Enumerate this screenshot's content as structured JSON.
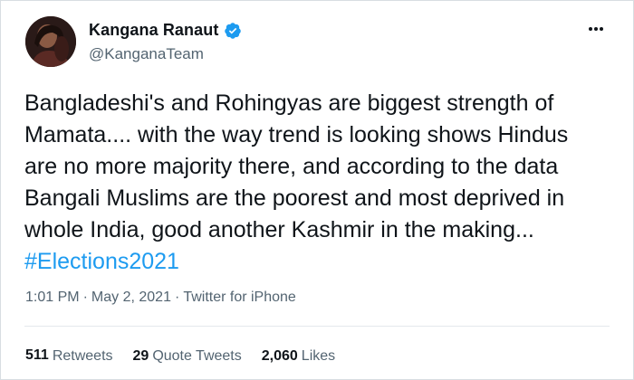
{
  "tweet": {
    "author": {
      "display_name": "Kangana Ranaut",
      "handle": "@KanganaTeam",
      "verified": true
    },
    "text": "Bangladeshi's and Rohingyas are biggest strength of\nMamata.... with the way trend is looking shows Hindus\nare no more majority there, and according to the data\nBangali Muslims are the poorest and most deprived in\nwhole India, good another Kashmir in the making...",
    "hashtag": "#Elections2021",
    "time": "1:01 PM",
    "date": "May 2, 2021",
    "source": "Twitter for iPhone",
    "separator": "·",
    "more_icon": "more-horizontal-icon"
  },
  "stats": {
    "retweets": {
      "count": "511",
      "label": "Retweets"
    },
    "quote_tweets": {
      "count": "29",
      "label": "Quote Tweets"
    },
    "likes": {
      "count": "2,060",
      "label": "Likes"
    }
  },
  "colors": {
    "accent": "#1d9bf0",
    "text": "#0f1419",
    "secondary": "#536471"
  }
}
